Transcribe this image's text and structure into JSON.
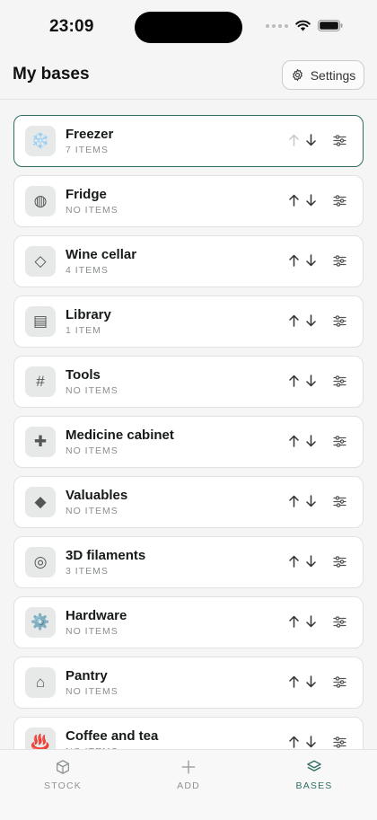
{
  "status_bar": {
    "time": "23:09"
  },
  "header": {
    "title": "My bases",
    "settings_label": "Settings"
  },
  "bases": [
    {
      "name": "Freezer",
      "count": "7 ITEMS",
      "icon": "snowflake-icon",
      "glyph": "❄️",
      "selected": true,
      "up_disabled": true
    },
    {
      "name": "Fridge",
      "count": "NO ITEMS",
      "icon": "fridge-icon",
      "glyph": "◍"
    },
    {
      "name": "Wine cellar",
      "count": "4 ITEMS",
      "icon": "diamond-outline-icon",
      "glyph": "◇"
    },
    {
      "name": "Library",
      "count": "1 ITEM",
      "icon": "book-icon",
      "glyph": "▤"
    },
    {
      "name": "Tools",
      "count": "NO ITEMS",
      "icon": "hash-icon",
      "glyph": "#"
    },
    {
      "name": "Medicine cabinet",
      "count": "NO ITEMS",
      "icon": "cross-icon",
      "glyph": "✚"
    },
    {
      "name": "Valuables",
      "count": "NO ITEMS",
      "icon": "diamond-filled-icon",
      "glyph": "◆"
    },
    {
      "name": "3D filaments",
      "count": "3 ITEMS",
      "icon": "spool-icon",
      "glyph": "◎"
    },
    {
      "name": "Hardware",
      "count": "NO ITEMS",
      "icon": "gear-icon",
      "glyph": "⚙️"
    },
    {
      "name": "Pantry",
      "count": "NO ITEMS",
      "icon": "house-icon",
      "glyph": "⌂"
    },
    {
      "name": "Coffee and tea",
      "count": "NO ITEMS",
      "icon": "hot-springs-icon",
      "glyph": "♨️"
    }
  ],
  "tabs": [
    {
      "label": "STOCK",
      "icon": "cube-icon",
      "active": false
    },
    {
      "label": "ADD",
      "icon": "plus-icon",
      "active": false
    },
    {
      "label": "BASES",
      "icon": "layers-icon",
      "active": true
    }
  ],
  "colors": {
    "accent": "#2f6f62",
    "background": "#f4f5f4",
    "card": "#ffffff"
  }
}
